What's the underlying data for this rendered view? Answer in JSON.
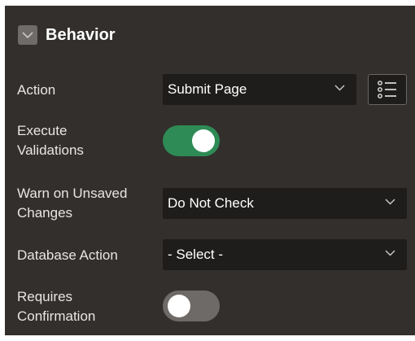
{
  "section": {
    "title": "Behavior",
    "collapse_icon": "chevron-down-icon"
  },
  "fields": {
    "action": {
      "label": "Action",
      "value": "Submit Page",
      "list_icon": "list-icon"
    },
    "execute_validations": {
      "label_line1": "Execute",
      "label_line2": "Validations",
      "enabled": true
    },
    "warn_unsaved": {
      "label_line1": "Warn on Unsaved",
      "label_line2": "Changes",
      "value": "Do Not Check"
    },
    "database_action": {
      "label": "Database Action",
      "value": "- Select -"
    },
    "requires_confirmation": {
      "label_line1": "Requires",
      "label_line2": "Confirmation",
      "enabled": false
    }
  },
  "colors": {
    "panel_bg": "#322f2d",
    "field_bg": "#1f1d1c",
    "toggle_on": "#2e8b55",
    "toggle_off": "#6d6a67"
  }
}
